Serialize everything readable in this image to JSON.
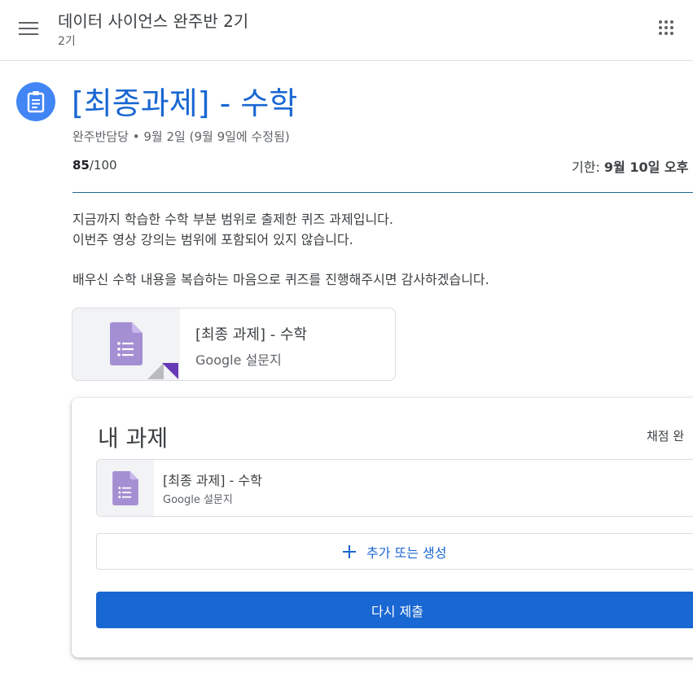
{
  "topbar": {
    "course_title": "데이터 사이언스 완주반 2기",
    "course_subtitle": "2기",
    "menu_icon": "hamburger-menu-icon",
    "apps_icon": "google-apps-icon"
  },
  "assignment": {
    "icon": "assignment-icon",
    "title": "[최종과제] - 수학",
    "meta": "완주반담당 • 9월 2일 (9월 9일에 수정됨)",
    "grade_score": "85",
    "grade_total": "/100",
    "due_prefix": "기한: ",
    "due_value": "9월 10일 오후",
    "description": [
      "지금까지 학습한 수학 부분 범위로 출제한 퀴즈 과제입니다.",
      "이번주 영상 강의는 범위에 포함되어 있지 않습니다.",
      "",
      "배우신 수학 내용을 복습하는 마음으로 퀴즈를 진행해주시면 감사하겠습니다."
    ],
    "attachment": {
      "title": "[최종 과제] - 수학",
      "type": "Google 설문지",
      "icon": "google-forms-icon"
    }
  },
  "my_work": {
    "title": "내 과제",
    "status": "채점 완",
    "file": {
      "title": "[최종 과제] - 수학",
      "type": "Google 설문지",
      "icon": "google-forms-icon"
    },
    "add_button_label": "추가 또는 생성",
    "resubmit_label": "다시 제출"
  },
  "colors": {
    "accent_blue": "#1967d2",
    "assignment_icon_bg": "#4285f4",
    "forms_purple": "#a48fd2",
    "forms_corner": "#673ab7"
  }
}
